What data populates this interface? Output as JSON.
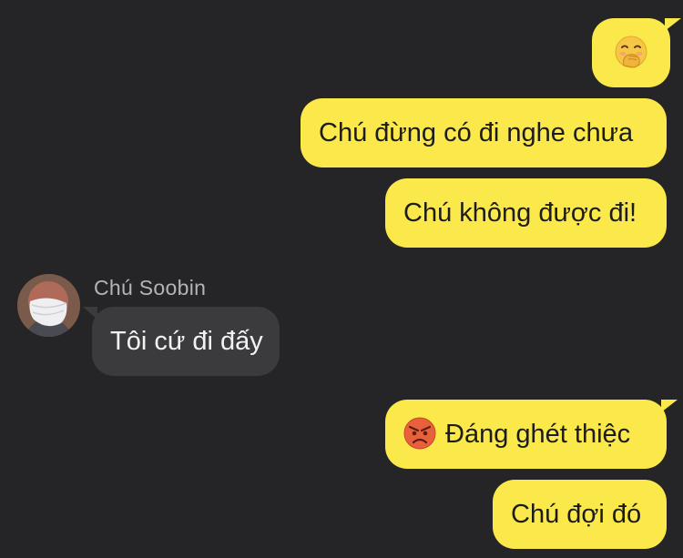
{
  "conversation": {
    "messages": [
      {
        "direction": "outgoing",
        "text": "",
        "emoji": "face-with-hand-over-mouth"
      },
      {
        "direction": "outgoing",
        "text": "Chú đừng có đi nghe chưa"
      },
      {
        "direction": "outgoing",
        "text": "Chú không được đi!"
      },
      {
        "direction": "incoming",
        "text": "Tôi cứ đi đấy"
      },
      {
        "direction": "outgoing",
        "text": "Đáng ghét thiệc",
        "emoji": "angry-face"
      },
      {
        "direction": "outgoing",
        "text": "Chú đợi đó"
      }
    ],
    "incoming_sender": {
      "name": "Chú Soobin",
      "avatar": "masked-person-photo"
    }
  },
  "theme": {
    "background": "#252527",
    "outgoing_bubble": "#FBE84B",
    "incoming_bubble": "#3b3b3d",
    "sender_name_color": "#b4b4b6"
  }
}
